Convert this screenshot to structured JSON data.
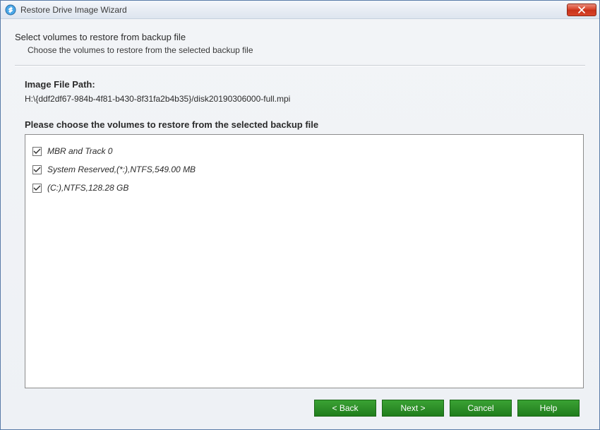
{
  "titlebar": {
    "title": "Restore Drive Image Wizard"
  },
  "header": {
    "title": "Select volumes to restore from backup file",
    "subtitle": "Choose the volumes to restore from the selected backup file"
  },
  "imagePath": {
    "label": "Image File Path:",
    "value": "H:\\{ddf2df67-984b-4f81-b430-8f31fa2b4b35}/disk20190306000-full.mpi"
  },
  "volumes": {
    "label": "Please choose the volumes to restore from the selected backup file",
    "items": [
      {
        "label": "MBR and Track 0",
        "checked": true
      },
      {
        "label": "System Reserved,(*:),NTFS,549.00 MB",
        "checked": true
      },
      {
        "label": "(C:),NTFS,128.28 GB",
        "checked": true
      }
    ]
  },
  "buttons": {
    "back": "< Back",
    "next": "Next >",
    "cancel": "Cancel",
    "help": "Help"
  },
  "colors": {
    "buttonGreen": "#2e8f29",
    "closeRed": "#d9442a"
  }
}
